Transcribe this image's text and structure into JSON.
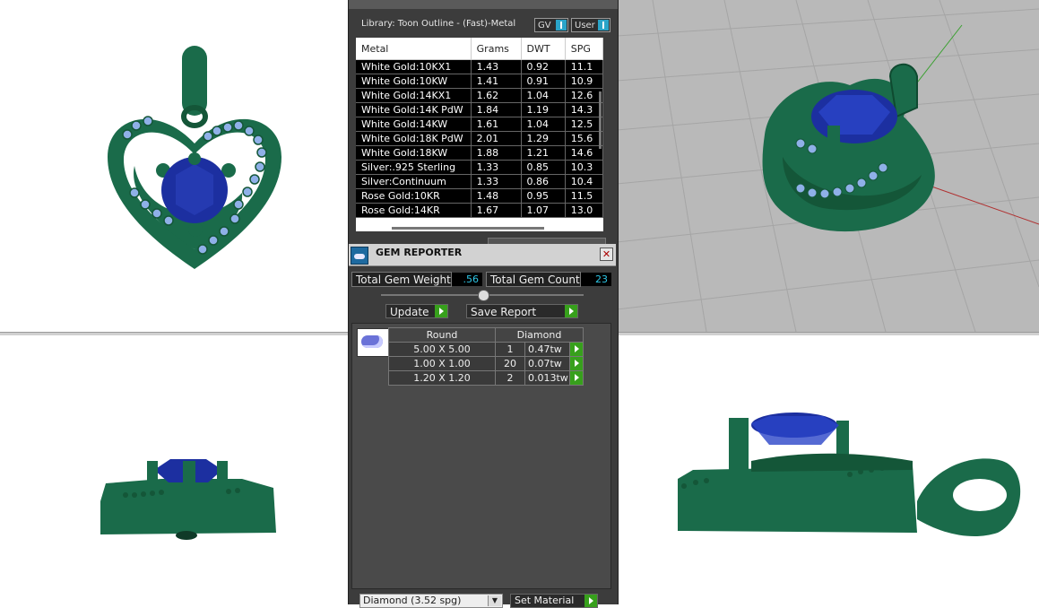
{
  "library": {
    "title": "Library: Toon Outline - (Fast)-Metal",
    "gv_label": "GV",
    "user_label": "User",
    "columns": [
      "Metal",
      "Grams",
      "DWT",
      "SPG"
    ],
    "rows": [
      [
        "White Gold:10KX1",
        "1.43",
        "0.92",
        "11.1"
      ],
      [
        "White Gold:10KW",
        "1.41",
        "0.91",
        "10.9"
      ],
      [
        "White Gold:14KX1",
        "1.62",
        "1.04",
        "12.6"
      ],
      [
        "White Gold:14K PdW",
        "1.84",
        "1.19",
        "14.3"
      ],
      [
        "White Gold:14KW",
        "1.61",
        "1.04",
        "12.5"
      ],
      [
        "White Gold:18K PdW",
        "2.01",
        "1.29",
        "15.6"
      ],
      [
        "White Gold:18KW",
        "1.88",
        "1.21",
        "14.6"
      ],
      [
        "Silver:.925 Sterling",
        "1.33",
        "0.85",
        "10.3"
      ],
      [
        "Silver:Continuum",
        "1.33",
        "0.86",
        "10.4"
      ],
      [
        "Rose Gold:10KR",
        "1.48",
        "0.95",
        "11.5"
      ],
      [
        "Rose Gold:14KR",
        "1.67",
        "1.07",
        "13.0"
      ]
    ]
  },
  "gem_reporter": {
    "title": "GEM REPORTER",
    "total_weight_label": "Total Gem Weight",
    "total_weight_value": ".56",
    "total_count_label": "Total Gem Count",
    "total_count_value": "23",
    "update_label": "Update",
    "save_label": "Save Report",
    "shape_header": "Round",
    "material_header": "Diamond",
    "gems": [
      {
        "size": "5.00 X 5.00",
        "count": "1",
        "tw": "0.47tw"
      },
      {
        "size": "1.00 X 1.00",
        "count": "20",
        "tw": "0.07tw"
      },
      {
        "size": "1.20 X 1.20",
        "count": "2",
        "tw": "0.013tw"
      }
    ],
    "material_select": "Diamond    (3.52 spg)",
    "set_material_label": "Set Material"
  },
  "colors": {
    "metal": "#1a6b4a",
    "center_stone": "#1c2fa0",
    "side_stone": "#8fb0e8",
    "accent": "#37a01c",
    "value_text": "#2ec7e6"
  }
}
